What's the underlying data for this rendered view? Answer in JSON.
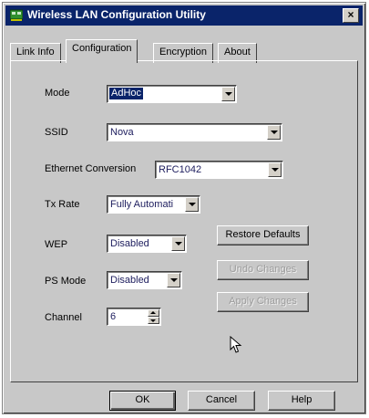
{
  "window": {
    "title": "Wireless LAN Configuration Utility",
    "close_glyph": "×",
    "titlebar_color": "#0a246a"
  },
  "tabs": [
    {
      "label": "Link Info",
      "active": false
    },
    {
      "label": "Configuration",
      "active": true
    },
    {
      "label": "Encryption",
      "active": false
    },
    {
      "label": "About",
      "active": false
    }
  ],
  "config": {
    "mode_label": "Mode",
    "mode_value": "AdHoc",
    "ssid_label": "SSID",
    "ssid_value": "Nova",
    "ethernet_label": "Ethernet Conversion",
    "ethernet_value": "RFC1042",
    "txrate_label": "Tx Rate",
    "txrate_value": "Fully Automati",
    "wep_label": "WEP",
    "wep_value": "Disabled",
    "psmode_label": "PS Mode",
    "psmode_value": "Disabled",
    "channel_label": "Channel",
    "channel_value": "6"
  },
  "actions": {
    "restore_defaults": "Restore Defaults",
    "undo_changes": "Undo Changes",
    "apply_changes": "Apply Changes"
  },
  "footer": {
    "ok": "OK",
    "cancel": "Cancel",
    "help": "Help"
  }
}
